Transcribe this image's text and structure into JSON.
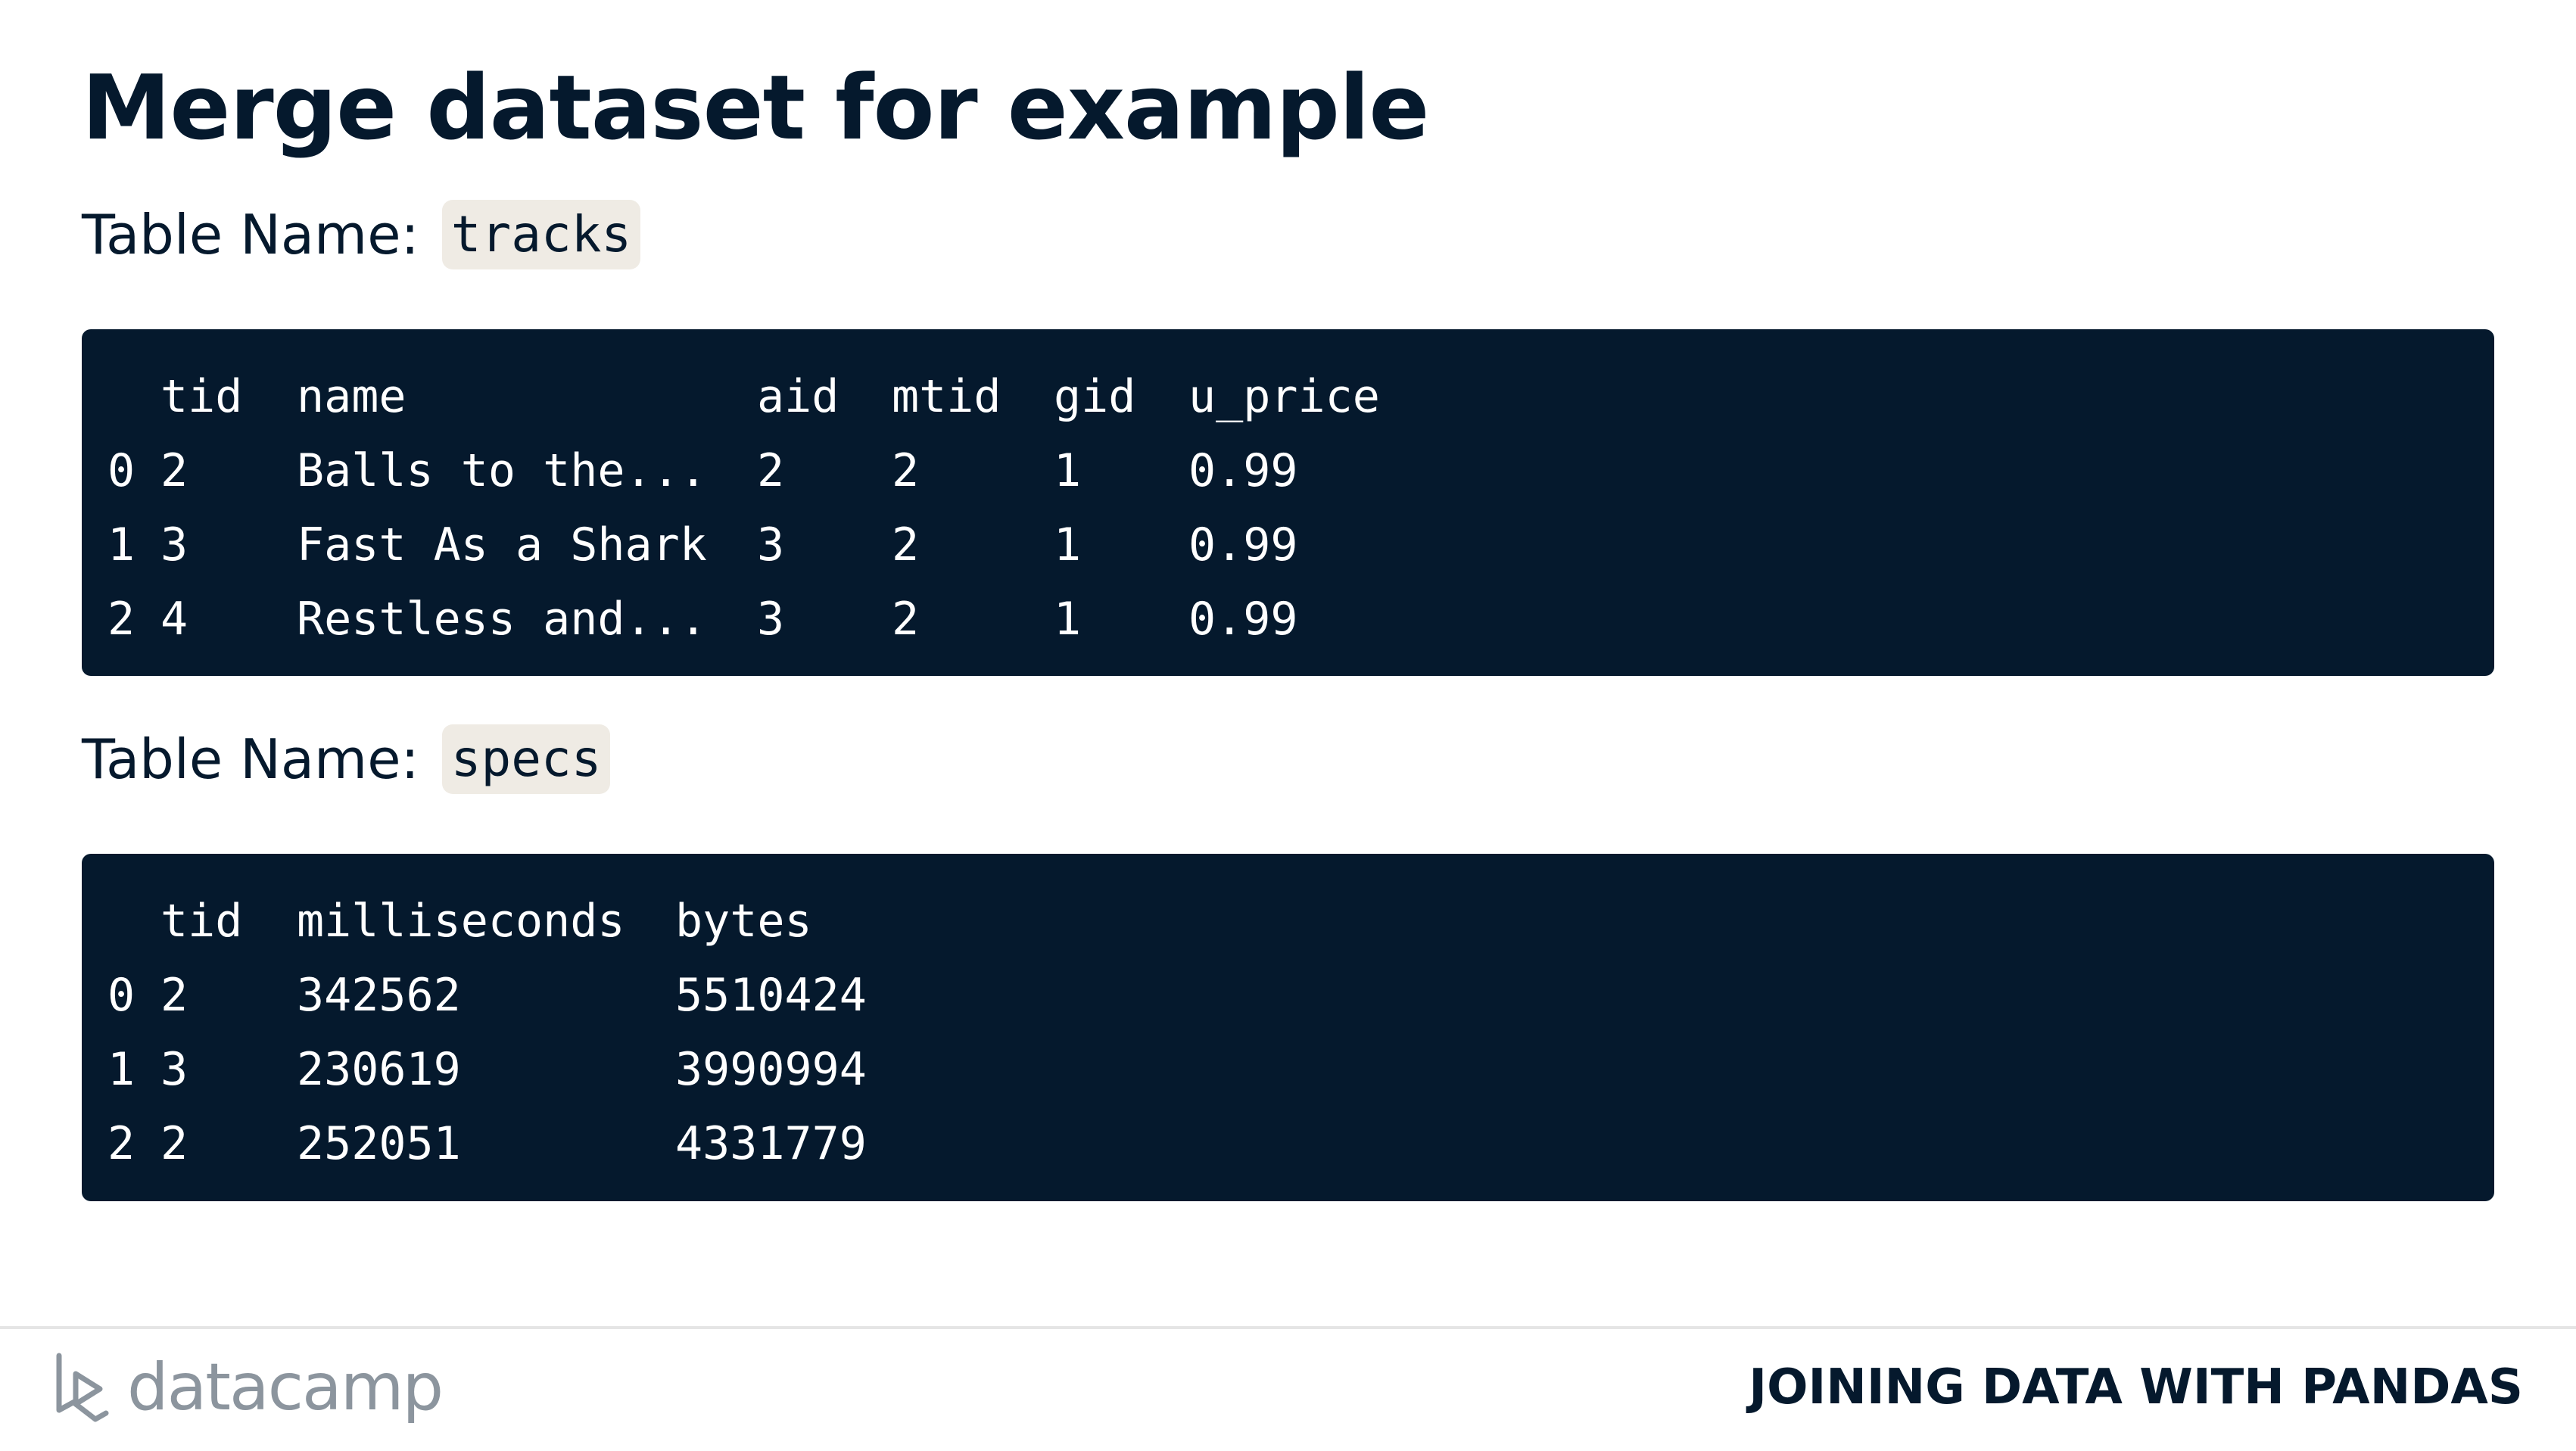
{
  "slide": {
    "title": "Merge dataset for example"
  },
  "tables": {
    "tracks": {
      "label": "Table Name:",
      "name": "tracks",
      "columns": [
        "tid",
        "name",
        "aid",
        "mtid",
        "gid",
        "u_price"
      ],
      "rows": [
        {
          "index": "0",
          "tid": "2",
          "name": "Balls to the...",
          "aid": "2",
          "mtid": "2",
          "gid": "1",
          "u_price": "0.99"
        },
        {
          "index": "1",
          "tid": "3",
          "name": "Fast As a Shark",
          "aid": "3",
          "mtid": "2",
          "gid": "1",
          "u_price": "0.99"
        },
        {
          "index": "2",
          "tid": "4",
          "name": "Restless and...",
          "aid": "3",
          "mtid": "2",
          "gid": "1",
          "u_price": "0.99"
        }
      ]
    },
    "specs": {
      "label": "Table Name:",
      "name": "specs",
      "columns": [
        "tid",
        "milliseconds",
        "bytes"
      ],
      "rows": [
        {
          "index": "0",
          "tid": "2",
          "milliseconds": "342562",
          "bytes": "5510424"
        },
        {
          "index": "1",
          "tid": "3",
          "milliseconds": "230619",
          "bytes": "3990994"
        },
        {
          "index": "2",
          "tid": "2",
          "milliseconds": "252051",
          "bytes": "4331779"
        }
      ]
    }
  },
  "footer": {
    "brand": "datacamp",
    "logo_icon": "datacamp-logo-icon",
    "course": "JOINING DATA WITH PANDAS"
  },
  "colors": {
    "navy": "#05192d",
    "code_bg": "#05192d",
    "tag_bg": "#efebe4",
    "logo_grey": "#8c959e"
  }
}
